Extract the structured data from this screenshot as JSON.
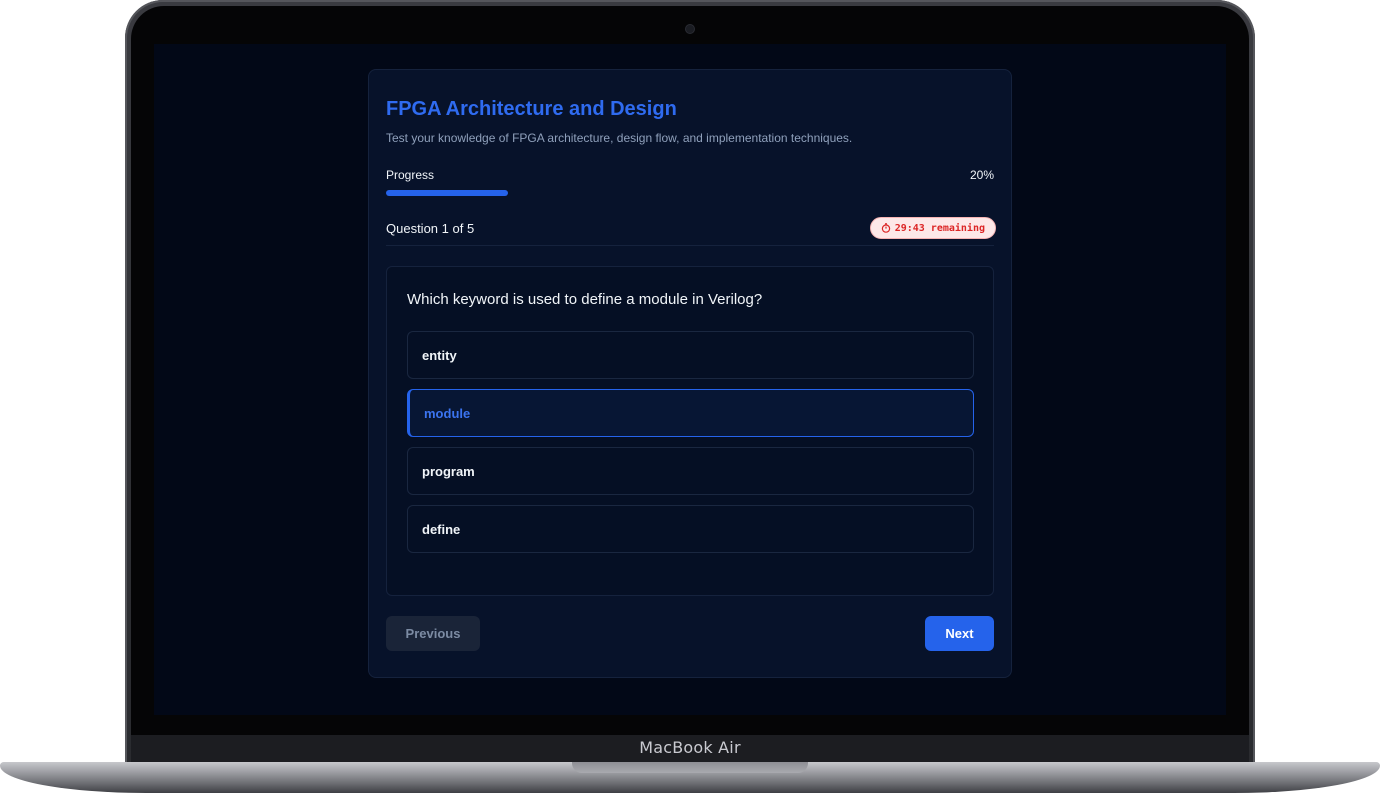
{
  "device": {
    "brand_label": "MacBook Air"
  },
  "quiz": {
    "title": "FPGA Architecture and Design",
    "subtitle": "Test your knowledge of FPGA architecture, design flow, and implementation techniques.",
    "progress": {
      "label": "Progress",
      "percent_text": "20%",
      "value": 0.2
    },
    "question_counter": "Question 1 of 5",
    "timer": {
      "icon": "stopwatch-icon",
      "text": "29:43 remaining"
    },
    "question": {
      "text": "Which keyword is used to define a module in Verilog?",
      "options": [
        {
          "label": "entity",
          "selected": false
        },
        {
          "label": "module",
          "selected": true
        },
        {
          "label": "program",
          "selected": false
        },
        {
          "label": "define",
          "selected": false
        }
      ]
    },
    "nav": {
      "previous_label": "Previous",
      "next_label": "Next"
    }
  },
  "colors": {
    "accent": "#2563eb",
    "screen_bg": "#020817",
    "card_bg": "#07122a",
    "timer_text": "#dc2626"
  }
}
